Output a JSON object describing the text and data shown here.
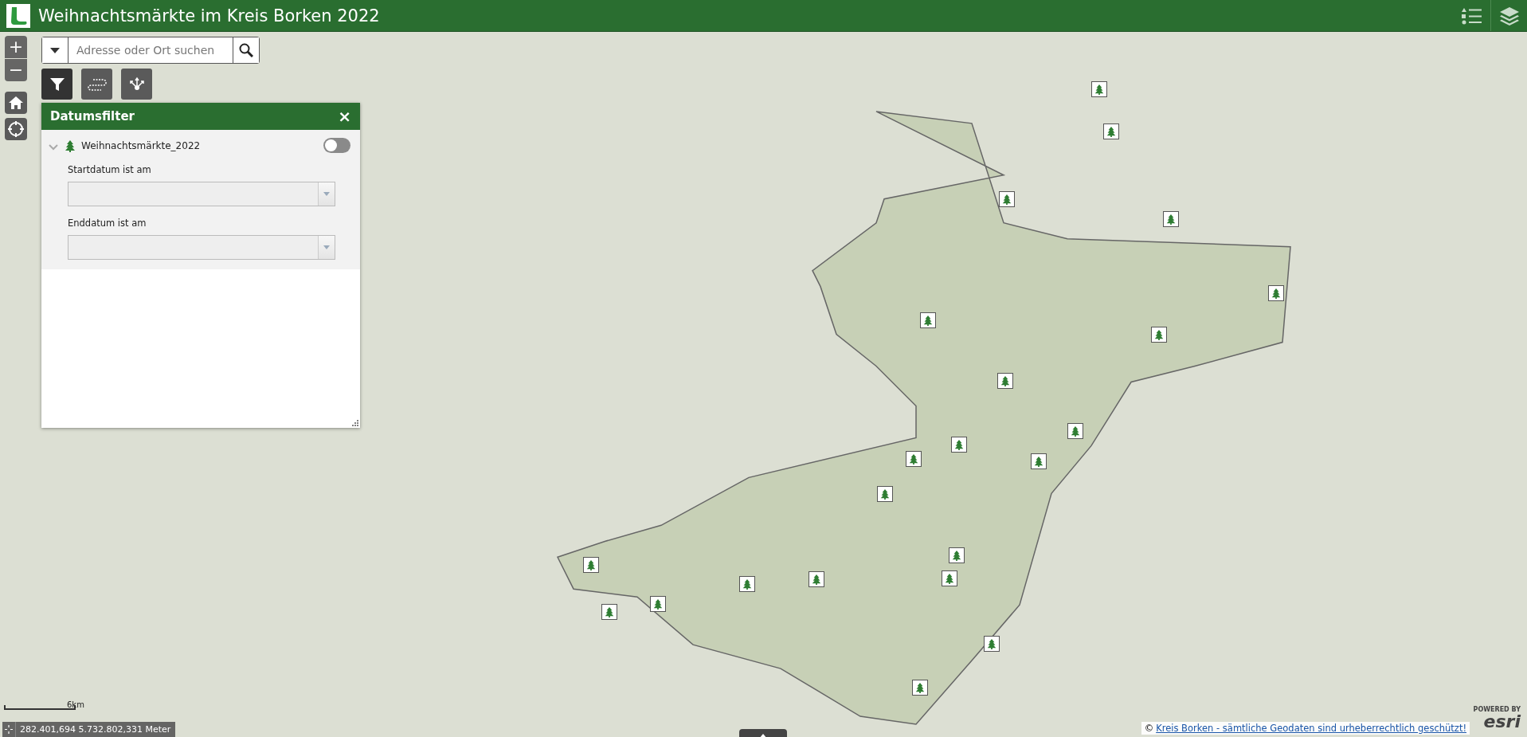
{
  "header": {
    "title": "Weihnachtsmärkte im Kreis Borken 2022"
  },
  "search": {
    "placeholder": "Adresse oder Ort suchen"
  },
  "zoom": {
    "in": "+",
    "out": "−"
  },
  "tools": [
    {
      "kind": "filter",
      "selected": true
    },
    {
      "kind": "route",
      "selected": false
    },
    {
      "kind": "share",
      "selected": false
    }
  ],
  "panel": {
    "title": "Datumsfilter",
    "close": "×",
    "layer": {
      "name": "Weihnachtsmärkte_2022",
      "expanded": true,
      "on": false
    },
    "fields": [
      {
        "label": "Startdatum ist am"
      },
      {
        "label": "Enddatum ist am"
      }
    ]
  },
  "scale": {
    "label": "6km"
  },
  "coordinates": "282.401,694 5.732.802,331 Meter",
  "attribution": {
    "symbol": "©",
    "link": "Kreis Borken - sämtliche Geodaten sind urheberrechtlich geschützt!"
  },
  "esri": {
    "powered": "POWERED BY",
    "brand": "esri"
  }
}
